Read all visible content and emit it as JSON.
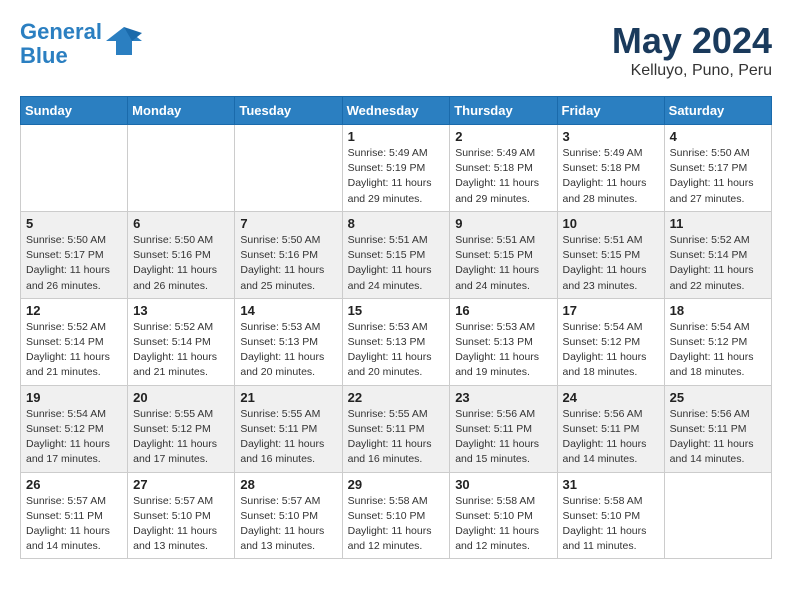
{
  "header": {
    "logo_line1": "General",
    "logo_line2": "Blue",
    "month": "May 2024",
    "location": "Kelluyo, Puno, Peru"
  },
  "weekdays": [
    "Sunday",
    "Monday",
    "Tuesday",
    "Wednesday",
    "Thursday",
    "Friday",
    "Saturday"
  ],
  "weeks": [
    [
      {
        "day": "",
        "info": ""
      },
      {
        "day": "",
        "info": ""
      },
      {
        "day": "",
        "info": ""
      },
      {
        "day": "1",
        "info": "Sunrise: 5:49 AM\nSunset: 5:19 PM\nDaylight: 11 hours\nand 29 minutes."
      },
      {
        "day": "2",
        "info": "Sunrise: 5:49 AM\nSunset: 5:18 PM\nDaylight: 11 hours\nand 29 minutes."
      },
      {
        "day": "3",
        "info": "Sunrise: 5:49 AM\nSunset: 5:18 PM\nDaylight: 11 hours\nand 28 minutes."
      },
      {
        "day": "4",
        "info": "Sunrise: 5:50 AM\nSunset: 5:17 PM\nDaylight: 11 hours\nand 27 minutes."
      }
    ],
    [
      {
        "day": "5",
        "info": "Sunrise: 5:50 AM\nSunset: 5:17 PM\nDaylight: 11 hours\nand 26 minutes."
      },
      {
        "day": "6",
        "info": "Sunrise: 5:50 AM\nSunset: 5:16 PM\nDaylight: 11 hours\nand 26 minutes."
      },
      {
        "day": "7",
        "info": "Sunrise: 5:50 AM\nSunset: 5:16 PM\nDaylight: 11 hours\nand 25 minutes."
      },
      {
        "day": "8",
        "info": "Sunrise: 5:51 AM\nSunset: 5:15 PM\nDaylight: 11 hours\nand 24 minutes."
      },
      {
        "day": "9",
        "info": "Sunrise: 5:51 AM\nSunset: 5:15 PM\nDaylight: 11 hours\nand 24 minutes."
      },
      {
        "day": "10",
        "info": "Sunrise: 5:51 AM\nSunset: 5:15 PM\nDaylight: 11 hours\nand 23 minutes."
      },
      {
        "day": "11",
        "info": "Sunrise: 5:52 AM\nSunset: 5:14 PM\nDaylight: 11 hours\nand 22 minutes."
      }
    ],
    [
      {
        "day": "12",
        "info": "Sunrise: 5:52 AM\nSunset: 5:14 PM\nDaylight: 11 hours\nand 21 minutes."
      },
      {
        "day": "13",
        "info": "Sunrise: 5:52 AM\nSunset: 5:14 PM\nDaylight: 11 hours\nand 21 minutes."
      },
      {
        "day": "14",
        "info": "Sunrise: 5:53 AM\nSunset: 5:13 PM\nDaylight: 11 hours\nand 20 minutes."
      },
      {
        "day": "15",
        "info": "Sunrise: 5:53 AM\nSunset: 5:13 PM\nDaylight: 11 hours\nand 20 minutes."
      },
      {
        "day": "16",
        "info": "Sunrise: 5:53 AM\nSunset: 5:13 PM\nDaylight: 11 hours\nand 19 minutes."
      },
      {
        "day": "17",
        "info": "Sunrise: 5:54 AM\nSunset: 5:12 PM\nDaylight: 11 hours\nand 18 minutes."
      },
      {
        "day": "18",
        "info": "Sunrise: 5:54 AM\nSunset: 5:12 PM\nDaylight: 11 hours\nand 18 minutes."
      }
    ],
    [
      {
        "day": "19",
        "info": "Sunrise: 5:54 AM\nSunset: 5:12 PM\nDaylight: 11 hours\nand 17 minutes."
      },
      {
        "day": "20",
        "info": "Sunrise: 5:55 AM\nSunset: 5:12 PM\nDaylight: 11 hours\nand 17 minutes."
      },
      {
        "day": "21",
        "info": "Sunrise: 5:55 AM\nSunset: 5:11 PM\nDaylight: 11 hours\nand 16 minutes."
      },
      {
        "day": "22",
        "info": "Sunrise: 5:55 AM\nSunset: 5:11 PM\nDaylight: 11 hours\nand 16 minutes."
      },
      {
        "day": "23",
        "info": "Sunrise: 5:56 AM\nSunset: 5:11 PM\nDaylight: 11 hours\nand 15 minutes."
      },
      {
        "day": "24",
        "info": "Sunrise: 5:56 AM\nSunset: 5:11 PM\nDaylight: 11 hours\nand 14 minutes."
      },
      {
        "day": "25",
        "info": "Sunrise: 5:56 AM\nSunset: 5:11 PM\nDaylight: 11 hours\nand 14 minutes."
      }
    ],
    [
      {
        "day": "26",
        "info": "Sunrise: 5:57 AM\nSunset: 5:11 PM\nDaylight: 11 hours\nand 14 minutes."
      },
      {
        "day": "27",
        "info": "Sunrise: 5:57 AM\nSunset: 5:10 PM\nDaylight: 11 hours\nand 13 minutes."
      },
      {
        "day": "28",
        "info": "Sunrise: 5:57 AM\nSunset: 5:10 PM\nDaylight: 11 hours\nand 13 minutes."
      },
      {
        "day": "29",
        "info": "Sunrise: 5:58 AM\nSunset: 5:10 PM\nDaylight: 11 hours\nand 12 minutes."
      },
      {
        "day": "30",
        "info": "Sunrise: 5:58 AM\nSunset: 5:10 PM\nDaylight: 11 hours\nand 12 minutes."
      },
      {
        "day": "31",
        "info": "Sunrise: 5:58 AM\nSunset: 5:10 PM\nDaylight: 11 hours\nand 11 minutes."
      },
      {
        "day": "",
        "info": ""
      }
    ]
  ]
}
